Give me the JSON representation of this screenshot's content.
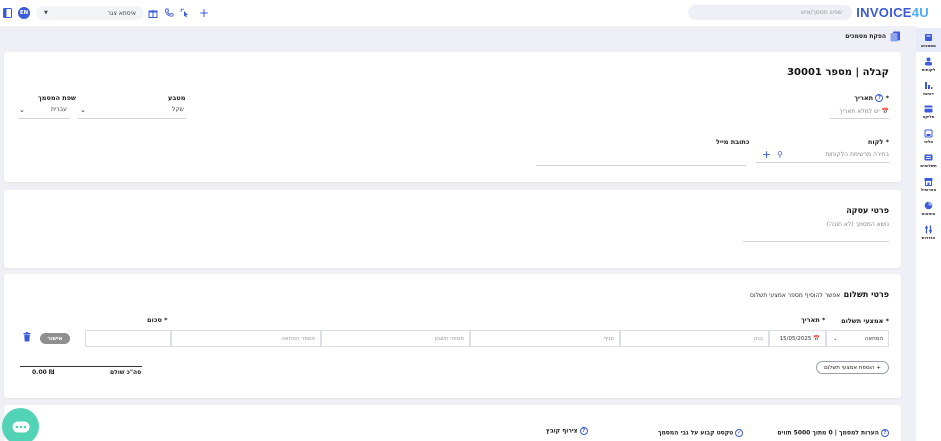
{
  "app": {
    "logo_main": "INVOICE",
    "logo_suffix": "4U",
    "search_placeholder": "שפש מסמך/איש",
    "business_selector": "איסתא צגר",
    "language": "EN"
  },
  "sidebar": {
    "items": [
      {
        "label": "מסמכים",
        "icon": "documents-icon",
        "active": true
      },
      {
        "label": "לקוחות",
        "icon": "customers-icon"
      },
      {
        "label": "דוחות",
        "icon": "reports-icon"
      },
      {
        "label": "סליקה",
        "icon": "credit-card-icon"
      },
      {
        "label": "מלאי",
        "icon": "inventory-icon"
      },
      {
        "label": "תשלומים",
        "icon": "payments-icon"
      },
      {
        "label": "הפרופיל",
        "icon": "storefront-icon"
      },
      {
        "label": "הוצאות",
        "icon": "expenses-icon"
      },
      {
        "label": "הגדרות",
        "icon": "settings-icon"
      }
    ]
  },
  "breadcrumb": {
    "label": "הפקת מסמכים"
  },
  "document": {
    "title": "קבלה | מספר 30001",
    "date_label": "תאריך",
    "date_placeholder": "יש למלא תאריך",
    "currency_label": "מטבע",
    "currency_value": "שקל",
    "language_label": "שפת המסמך",
    "language_value": "עברית",
    "customer_label": "לקוח",
    "customer_placeholder": "בחירה מרשימת הלקוחות",
    "email_label": "כתובת מייל"
  },
  "deal": {
    "title": "פרטי עסקה",
    "subject_placeholder": "נושא המסמך (לא חובה)"
  },
  "payments": {
    "title": "פרטי תשלום",
    "multi_hint": "אפשר להוסיף מספר אמצעי תשלום",
    "col_method": "אמצעי תשלום",
    "col_date": "תאריך",
    "col_amount": "סכום",
    "method_value": "המחאה",
    "date_value": "15/05/2025",
    "bank_placeholder": "בנק",
    "branch_placeholder": "סניף",
    "account_placeholder": "מספר חשבון",
    "check_placeholder": "מספר המחאה",
    "confirm_label": "אישור",
    "total_label": "סה\"כ שולם",
    "total_value": "0.00 ₪",
    "add_method_label": "הוספת אמצעי תשלום +"
  },
  "footer": {
    "notes_label": "הערות למסמך | 0 מתוך 5000 תווים",
    "fixed_text_label": "טקסט קבוע על גבי המסמך",
    "attach_label": "צירוף קובץ"
  }
}
